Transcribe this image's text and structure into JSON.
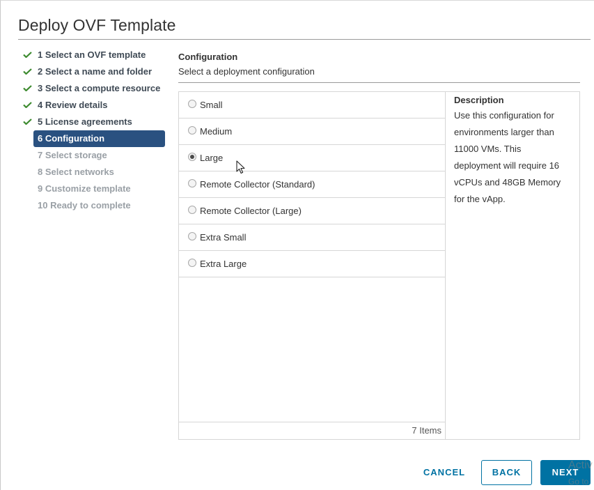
{
  "dialog": {
    "title": "Deploy OVF Template"
  },
  "steps": [
    {
      "label": "1 Select an OVF template",
      "state": "done"
    },
    {
      "label": "2 Select a name and folder",
      "state": "done"
    },
    {
      "label": "3 Select a compute resource",
      "state": "done"
    },
    {
      "label": "4 Review details",
      "state": "done"
    },
    {
      "label": "5 License agreements",
      "state": "done"
    },
    {
      "label": "6 Configuration",
      "state": "active"
    },
    {
      "label": "7 Select storage",
      "state": "pending"
    },
    {
      "label": "8 Select networks",
      "state": "pending"
    },
    {
      "label": "9 Customize template",
      "state": "pending"
    },
    {
      "label": "10 Ready to complete",
      "state": "pending"
    }
  ],
  "configuration": {
    "heading": "Configuration",
    "subheading": "Select a deployment configuration",
    "options": [
      {
        "label": "Small",
        "selected": false
      },
      {
        "label": "Medium",
        "selected": false
      },
      {
        "label": "Large",
        "selected": true
      },
      {
        "label": "Remote Collector (Standard)",
        "selected": false
      },
      {
        "label": "Remote Collector (Large)",
        "selected": false
      },
      {
        "label": "Extra Small",
        "selected": false
      },
      {
        "label": "Extra Large",
        "selected": false
      }
    ],
    "footer_count": "7 Items",
    "description_title": "Description",
    "description_lines": [
      "Use this configuration for",
      "environments larger than",
      "11000 VMs. This",
      "deployment will require 16",
      "vCPUs and 48GB Memory",
      "for the vApp."
    ]
  },
  "buttons": {
    "cancel": "CANCEL",
    "back": "BACK",
    "next": "NEXT"
  },
  "watermark": {
    "line1": "Activ",
    "line2": "Go to"
  },
  "colors": {
    "accent": "#0072a3",
    "active_step_bg": "#2a5180",
    "check_green": "#3c8a2e"
  },
  "icons": {
    "check": "check-icon",
    "cursor": "mouse-pointer-icon"
  }
}
